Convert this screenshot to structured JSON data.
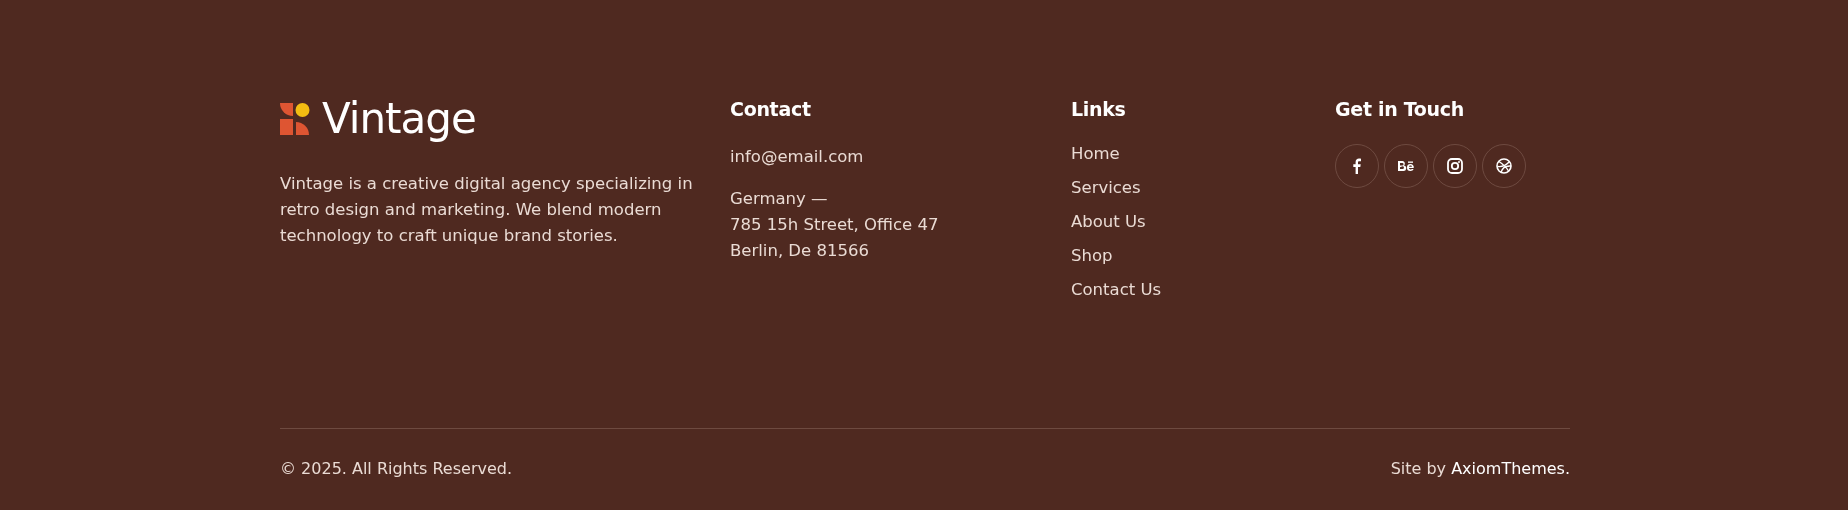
{
  "brand": {
    "name": "Vintage",
    "description": "Vintage is a creative digital agency specializing in retro design and marketing. We blend modern technology to craft unique brand stories."
  },
  "contact": {
    "title": "Contact",
    "email": "info@email.com",
    "address": [
      "Germany —",
      "785 15h Street, Office 47",
      "Berlin, De 81566"
    ]
  },
  "links": {
    "title": "Links",
    "items": [
      "Home",
      "Services",
      "About Us",
      "Shop",
      "Contact Us"
    ]
  },
  "get_in_touch": {
    "title": "Get in Touch",
    "socials": [
      {
        "kind": "facebook"
      },
      {
        "kind": "behance"
      },
      {
        "kind": "instagram"
      },
      {
        "kind": "dribbble"
      }
    ]
  },
  "bottom": {
    "copyright": "© 2025. All Rights Reserved.",
    "credit_prefix": "Site by",
    "credit_link": "AxiomThemes."
  }
}
